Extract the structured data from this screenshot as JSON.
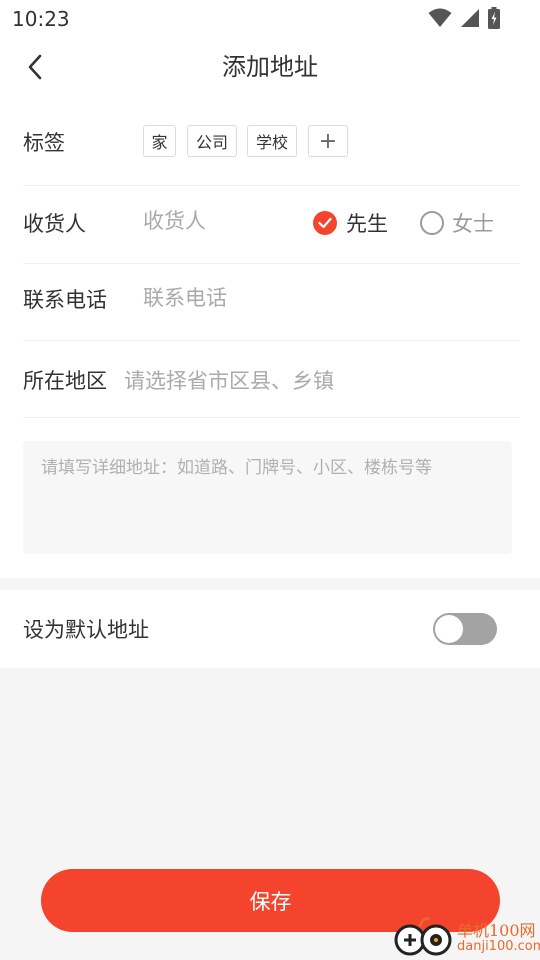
{
  "status_bar": {
    "time": "10:23"
  },
  "nav": {
    "title": "添加地址"
  },
  "tags": {
    "label": "标签",
    "items": [
      "家",
      "公司",
      "学校"
    ],
    "add_symbol": "+"
  },
  "recipient": {
    "label": "收货人",
    "placeholder": "收货人",
    "options": [
      {
        "label": "先生",
        "checked": true
      },
      {
        "label": "女士",
        "checked": false
      }
    ]
  },
  "phone": {
    "label": "联系电话",
    "placeholder": "联系电话"
  },
  "region": {
    "label": "所在地区",
    "placeholder": "请选择省市区县、乡镇"
  },
  "detail": {
    "placeholder": "请填写详细地址：如道路、门牌号、小区、楼栋号等"
  },
  "default_address": {
    "label": "设为默认地址",
    "enabled": false
  },
  "save": {
    "label": "保存"
  },
  "watermark": {
    "line1": "单机100网",
    "line2": "danji100.com"
  },
  "colors": {
    "accent": "#f4442e",
    "placeholder": "#aaaaaa",
    "toggle_off": "#a3a3a3"
  }
}
